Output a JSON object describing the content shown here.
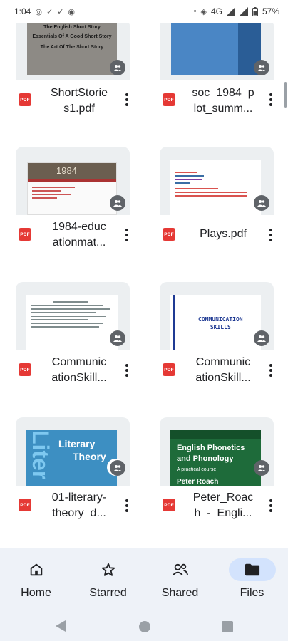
{
  "status_bar": {
    "time": "1:04",
    "network": "4G",
    "battery": "57%"
  },
  "files": [
    {
      "name_line1": "ShortStorie",
      "name_line2": "s1.pdf",
      "type_label": "PDF",
      "thumb_text": [
        "The English Short Story",
        "Essentials Of A Good Short Story",
        "The Art Of The Short Story"
      ]
    },
    {
      "name_line1": "soc_1984_p",
      "name_line2": "lot_summ...",
      "type_label": "PDF"
    },
    {
      "name_line1": "1984-educ",
      "name_line2": "ationmat...",
      "type_label": "PDF",
      "thumb_text": [
        "1984"
      ]
    },
    {
      "name_line1": "Plays.pdf",
      "name_line2": "",
      "type_label": "PDF"
    },
    {
      "name_line1": "Communic",
      "name_line2": "ationSkill...",
      "type_label": "PDF"
    },
    {
      "name_line1": "Communic",
      "name_line2": "ationSkill...",
      "type_label": "PDF",
      "thumb_text": [
        "COMMUNICATION",
        "SKILLS"
      ]
    },
    {
      "name_line1": "01-literary-",
      "name_line2": "theory_d...",
      "type_label": "PDF",
      "thumb_text": [
        "Liter",
        "Literary",
        "Theory"
      ]
    },
    {
      "name_line1": "Peter_Roac",
      "name_line2": "h_-_Engli...",
      "type_label": "PDF",
      "thumb_text": [
        "English Phonetics",
        "and Phonology",
        "A practical course",
        "Peter Roach"
      ]
    }
  ],
  "bottom_nav": {
    "items": [
      {
        "label": "Home",
        "icon": "home-icon"
      },
      {
        "label": "Starred",
        "icon": "star-icon"
      },
      {
        "label": "Shared",
        "icon": "shared-people-icon"
      },
      {
        "label": "Files",
        "icon": "folder-icon",
        "active": true
      }
    ]
  },
  "colors": {
    "pdf_red": "#e53935",
    "nav_bg": "#eef2f8",
    "active_pill": "#d3e3fd",
    "thumb_bg": "#eceff1"
  }
}
